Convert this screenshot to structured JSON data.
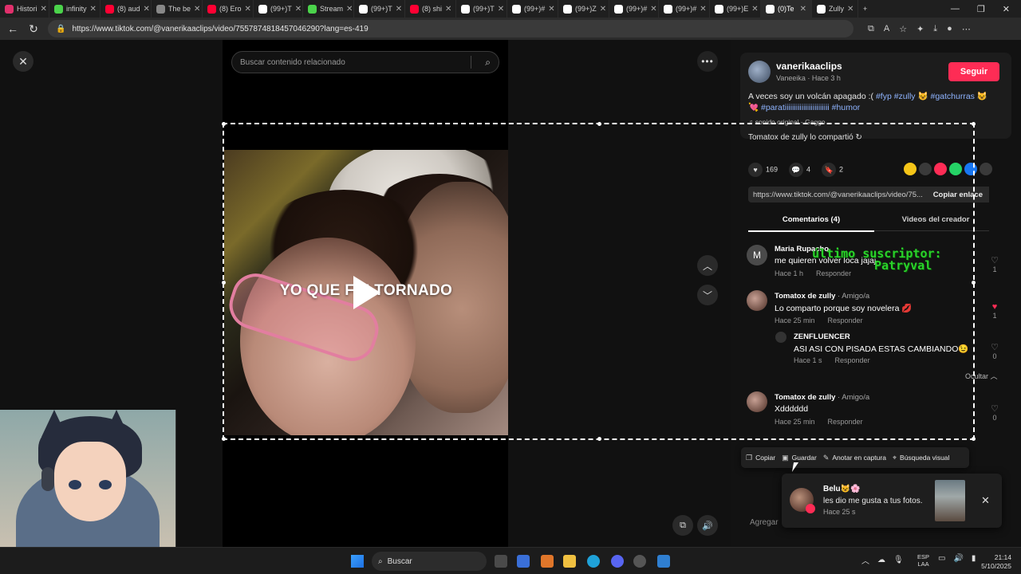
{
  "browser": {
    "tabs": [
      {
        "label": "Histori",
        "color": "#e1306c",
        "active": false
      },
      {
        "label": "infinity",
        "color": "#4bd34b",
        "active": false
      },
      {
        "label": "(8) aud",
        "color": "#ff0033",
        "active": false
      },
      {
        "label": "The be",
        "color": "#888888",
        "active": false
      },
      {
        "label": "(8) Ero",
        "color": "#ff0033",
        "active": false
      },
      {
        "label": "(99+)T",
        "color": "#ffffff",
        "active": false
      },
      {
        "label": "Stream",
        "color": "#4bd34b",
        "active": false
      },
      {
        "label": "(99+)T",
        "color": "#ffffff",
        "active": false
      },
      {
        "label": "(8) shi",
        "color": "#ff0033",
        "active": false
      },
      {
        "label": "(99+)T",
        "color": "#ffffff",
        "active": false
      },
      {
        "label": "(99+)#",
        "color": "#ffffff",
        "active": false
      },
      {
        "label": "(99+)Z",
        "color": "#ffffff",
        "active": false
      },
      {
        "label": "(99+)#",
        "color": "#ffffff",
        "active": false
      },
      {
        "label": "(99+)#",
        "color": "#ffffff",
        "active": false
      },
      {
        "label": "(99+)E",
        "color": "#ffffff",
        "active": false
      },
      {
        "label": "(0)Te",
        "color": "#ffffff",
        "active": true
      },
      {
        "label": "Zully",
        "color": "#ffffff",
        "active": false
      }
    ],
    "url": "https://www.tiktok.com/@vanerikaaclips/video/7557874818457046290?lang=es-419"
  },
  "search": {
    "placeholder": "Buscar contenido relacionado"
  },
  "video": {
    "overlay_text": "YO QUE FUI TORNADO"
  },
  "author": {
    "name": "vanerikaaclips",
    "sub": "Vaneeika · Hace 3 h",
    "follow_label": "Seguir"
  },
  "description": {
    "text": "A veces soy un volcán apagado :(",
    "tags_line1": "#fyp #zully",
    "tags_line2_a": "#gatchurras",
    "tags_line2_b": "#paratiiiiiiiiiiiiiiiiiiiiiiii #humor",
    "sound": "♫ sonido original - Gaggo",
    "shared": "Tomatox de zully lo compartió"
  },
  "stats": {
    "likes": "169",
    "comments": "4",
    "saves": "2"
  },
  "share_link": {
    "url": "https://www.tiktok.com/@vanerikaaclips/video/75...",
    "copy_label": "Copiar enlace"
  },
  "tabs": {
    "comments": "Comentarios (4)",
    "creator": "Videos del creador"
  },
  "comments": [
    {
      "name": "Maria Rupacho",
      "sub": "",
      "text": "me quieren volver loca jajaj",
      "time": "Hace 1 h",
      "reply": "Responder",
      "likes": "1"
    },
    {
      "name": "Tomatox de zully",
      "sub": " · Amigo/a",
      "text": "Lo comparto porque soy novelera 💋",
      "time": "Hace 25 min",
      "reply": "Responder",
      "likes": "1"
    },
    {
      "name": "ZENFLUENCER",
      "sub": "",
      "text": "ASI ASI CON PISADA ESTAS CAMBIANDO😉",
      "time": "Hace 1 s",
      "reply": "Responder",
      "likes": "0"
    },
    {
      "name": "Tomatox de zully",
      "sub": " · Amigo/a",
      "text": "Xdddddd",
      "time": "Hace 25 min",
      "reply": "Responder",
      "likes": "0"
    }
  ],
  "hide_label": "Ocultar",
  "stream_overlay": {
    "line1": "último suscriptor:",
    "line2": "Patryval"
  },
  "snip_toolbar": {
    "copy": "Copiar",
    "save": "Guardar",
    "annotate": "Anotar en captura",
    "visual_search": "Búsqueda visual"
  },
  "notification": {
    "name": "Belu😺🌸",
    "text": "les dio me gusta a tus fotos.",
    "time": "Hace 25 s"
  },
  "add_comment_placeholder": "Agregar",
  "taskbar": {
    "search_label": "Buscar",
    "lang_line1": "ESP",
    "lang_line2": "LAA",
    "time": "21:14",
    "date": "5/10/2025"
  },
  "colors": {
    "accent": "#fe2c55",
    "hashtag": "#8fb4ff",
    "overlay_green": "#2ad12a"
  }
}
